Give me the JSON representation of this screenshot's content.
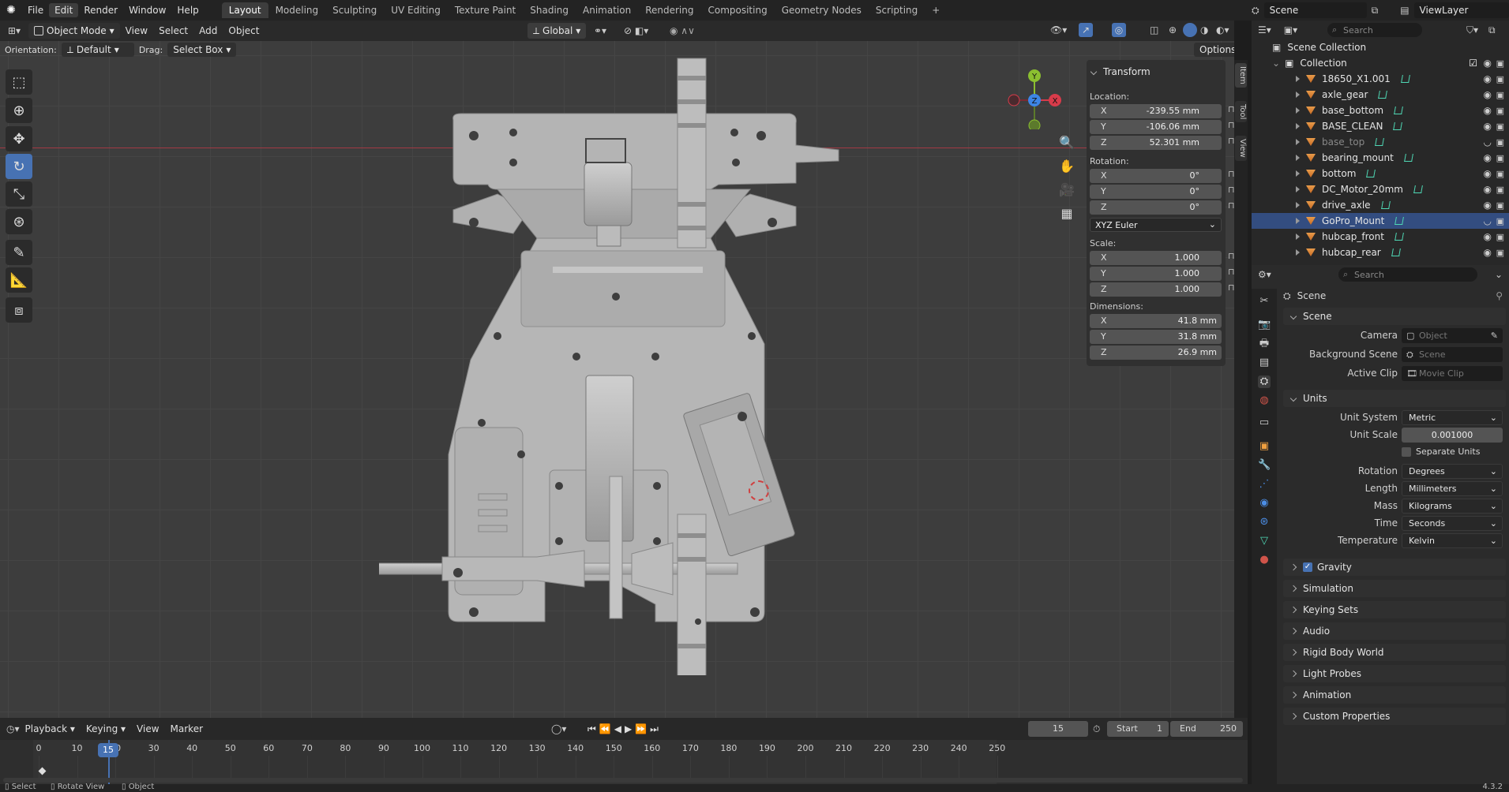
{
  "topbar": {
    "menus": [
      "File",
      "Edit",
      "Render",
      "Window",
      "Help"
    ],
    "workspaces": [
      "Layout",
      "Modeling",
      "Sculpting",
      "UV Editing",
      "Texture Paint",
      "Shading",
      "Animation",
      "Rendering",
      "Compositing",
      "Geometry Nodes",
      "Scripting"
    ],
    "add_tab": "+",
    "scene": "Scene",
    "view_layer": "ViewLayer"
  },
  "viewport_header": {
    "mode": "Object Mode",
    "menus": [
      "View",
      "Select",
      "Add",
      "Object"
    ],
    "transform_orientation": "Global",
    "orientation_label": "Orientation:",
    "orientation_value": "Default",
    "drag_label": "Drag:",
    "drag_value": "Select Box",
    "options": "Options"
  },
  "gizmo": {
    "x": "X",
    "y": "Y",
    "z": "Z"
  },
  "transform_panel": {
    "title": "Transform",
    "location_label": "Location:",
    "location": [
      {
        "axis": "X",
        "value": "-239.55 mm"
      },
      {
        "axis": "Y",
        "value": "-106.06 mm"
      },
      {
        "axis": "Z",
        "value": "52.301 mm"
      }
    ],
    "rotation_label": "Rotation:",
    "rotation": [
      {
        "axis": "X",
        "value": "0°"
      },
      {
        "axis": "Y",
        "value": "0°"
      },
      {
        "axis": "Z",
        "value": "0°"
      }
    ],
    "rotation_mode": "XYZ Euler",
    "scale_label": "Scale:",
    "scale": [
      {
        "axis": "X",
        "value": "1.000"
      },
      {
        "axis": "Y",
        "value": "1.000"
      },
      {
        "axis": "Z",
        "value": "1.000"
      }
    ],
    "dimensions_label": "Dimensions:",
    "dimensions": [
      {
        "axis": "X",
        "value": "41.8 mm"
      },
      {
        "axis": "Y",
        "value": "31.8 mm"
      },
      {
        "axis": "Z",
        "value": "26.9 mm"
      }
    ]
  },
  "side_tabs": [
    "Item",
    "Tool",
    "View"
  ],
  "outliner": {
    "search_placeholder": "Search",
    "scene_collection": "Scene Collection",
    "collection": "Collection",
    "objects": [
      {
        "name": "18650_X1.001",
        "hidden": false,
        "selected": false
      },
      {
        "name": "axle_gear",
        "hidden": false,
        "selected": false
      },
      {
        "name": "base_bottom",
        "hidden": false,
        "selected": false
      },
      {
        "name": "BASE_CLEAN",
        "hidden": false,
        "selected": false
      },
      {
        "name": "base_top",
        "hidden": true,
        "selected": false
      },
      {
        "name": "bearing_mount",
        "hidden": false,
        "selected": false
      },
      {
        "name": "bottom",
        "hidden": false,
        "selected": false
      },
      {
        "name": "DC_Motor_20mm",
        "hidden": false,
        "selected": false
      },
      {
        "name": "drive_axle",
        "hidden": false,
        "selected": false
      },
      {
        "name": "GoPro_Mount",
        "hidden": true,
        "selected": true
      },
      {
        "name": "hubcap_front",
        "hidden": false,
        "selected": false
      },
      {
        "name": "hubcap_rear",
        "hidden": false,
        "selected": false
      }
    ]
  },
  "properties": {
    "search_placeholder": "Search",
    "context": "Scene",
    "scene_section": "Scene",
    "camera_label": "Camera",
    "camera_placeholder": "Object",
    "bg_scene_label": "Background Scene",
    "bg_scene_placeholder": "Scene",
    "active_clip_label": "Active Clip",
    "active_clip_placeholder": "Movie Clip",
    "units_section": "Units",
    "unit_system_label": "Unit System",
    "unit_system": "Metric",
    "unit_scale_label": "Unit Scale",
    "unit_scale": "0.001000",
    "separate_units": "Separate Units",
    "rotation_label": "Rotation",
    "rotation": "Degrees",
    "length_label": "Length",
    "length": "Millimeters",
    "mass_label": "Mass",
    "mass": "Kilograms",
    "time_label": "Time",
    "time": "Seconds",
    "temperature_label": "Temperature",
    "temperature": "Kelvin",
    "collapsed_sections": [
      "Gravity",
      "Simulation",
      "Keying Sets",
      "Audio",
      "Rigid Body World",
      "Light Probes",
      "Animation",
      "Custom Properties"
    ]
  },
  "timeline": {
    "menus": [
      "Playback",
      "Keying",
      "View",
      "Marker"
    ],
    "current_frame": "15",
    "start_label": "Start",
    "start": "1",
    "end_label": "End",
    "end": "250",
    "ruler": [
      "0",
      "10",
      "20",
      "30",
      "40",
      "50",
      "60",
      "70",
      "80",
      "90",
      "100",
      "110",
      "120",
      "130",
      "140",
      "150",
      "160",
      "170",
      "180",
      "190",
      "200",
      "210",
      "220",
      "230",
      "240",
      "250"
    ],
    "playhead": "15"
  },
  "statusbar": {
    "select": "Select",
    "rotate_view": "Rotate View",
    "object": "Object",
    "version": "4.3.2"
  },
  "colors": {
    "accent": "#4772b3",
    "selection": "#334d80",
    "axis_x": "#d83b4a",
    "axis_y": "#8bbf30",
    "axis_z": "#3d85e6"
  }
}
